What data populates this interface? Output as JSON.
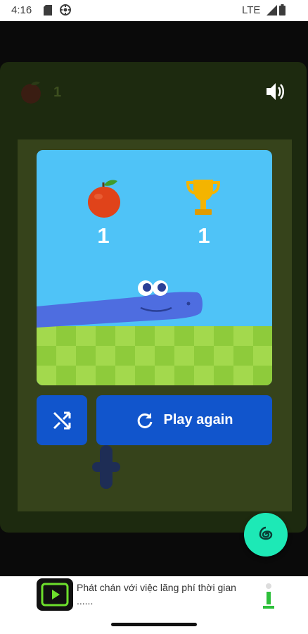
{
  "status_bar": {
    "time": "4:16",
    "network": "LTE",
    "icons": [
      "sd-card-icon",
      "vpn-icon",
      "signal-icon",
      "battery-icon"
    ]
  },
  "game": {
    "top_bar": {
      "apple_count": "1",
      "icons": [
        "apple-icon",
        "sound-icon"
      ]
    },
    "result_card": {
      "apples_score": "1",
      "best_score": "1",
      "icons": [
        "apple-icon",
        "trophy-icon"
      ]
    },
    "buttons": {
      "shuffle_icon": "shuffle-icon",
      "play_again_label": "Play again",
      "play_again_icon": "replay-icon"
    },
    "fab_icon": "spiral-icon",
    "colors": {
      "sky": "#4fc3f7",
      "snake": "#4e6de0",
      "grass_light": "#a3d94d",
      "grass_dark": "#8ecb3b",
      "button": "#1155cc",
      "fab": "#1de9b6",
      "panel": "#1d2a0f",
      "board": "#36431b"
    }
  },
  "ad": {
    "text_line1": "Phát chán với việc lãng phí thời gian",
    "text_line2": "......"
  }
}
